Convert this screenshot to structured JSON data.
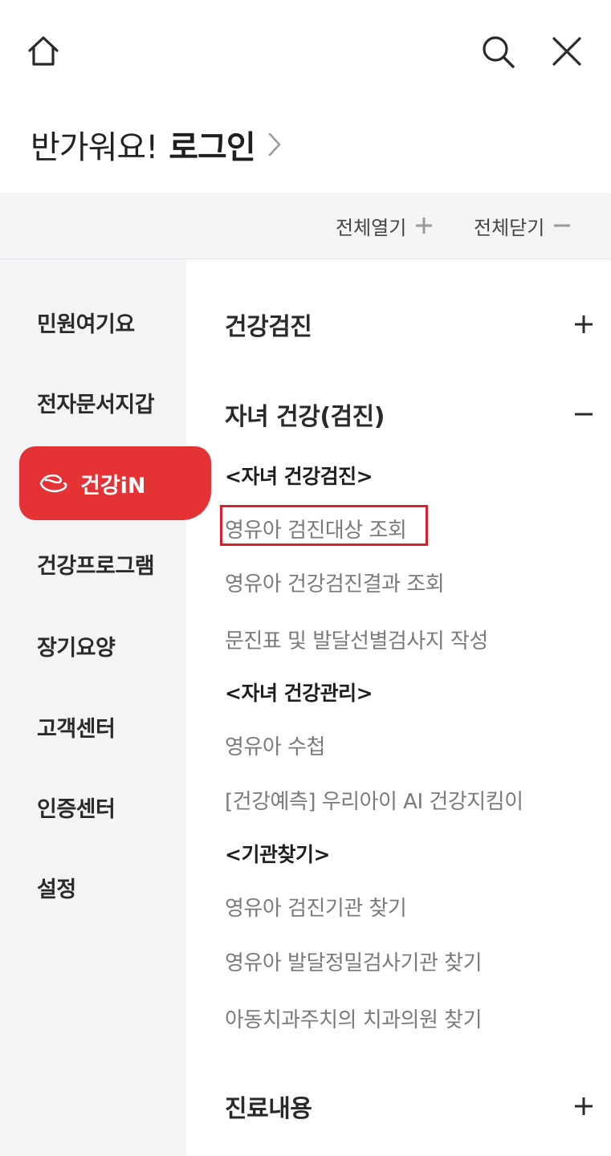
{
  "header": {
    "home_icon": "home-icon",
    "search_icon": "search-icon",
    "close_icon": "close-icon",
    "greeting": "반가워요!",
    "login_label": "로그인"
  },
  "controls": {
    "expand_all": "전체열기",
    "collapse_all": "전체닫기"
  },
  "sidebar": {
    "items": [
      {
        "label": "민원여기요"
      },
      {
        "label": "전자문서지갑"
      },
      {
        "label": "건강iN",
        "active": true,
        "icon": "health-in-icon"
      },
      {
        "label": "건강프로그램"
      },
      {
        "label": "장기요양"
      },
      {
        "label": "고객센터"
      },
      {
        "label": "인증센터"
      },
      {
        "label": "설정"
      }
    ]
  },
  "menu": {
    "sections": [
      {
        "title": "건강검진",
        "expanded": false
      },
      {
        "title": "자녀 건강(검진)",
        "expanded": true,
        "groups": [
          {
            "heading": "<자녀 건강검진>",
            "links": [
              "영유아 검진대상 조회",
              "영유아 건강검진결과 조회",
              "문진표 및 발달선별검사지 작성"
            ]
          },
          {
            "heading": "<자녀 건강관리>",
            "links": [
              "영유아 수첩",
              "[건강예측] 우리아이 AI 건강지킴이"
            ]
          },
          {
            "heading": "<기관찾기>",
            "links": [
              "영유아 검진기관 찾기",
              "영유아 발달정밀검사기관 찾기",
              "아동치과주치의 치과의원 찾기"
            ]
          }
        ]
      },
      {
        "title": "진료내용",
        "expanded": false
      }
    ]
  },
  "colors": {
    "accent": "#e53235",
    "highlight_border": "#d9202a",
    "sidebar_bg": "#f4f4f6"
  }
}
